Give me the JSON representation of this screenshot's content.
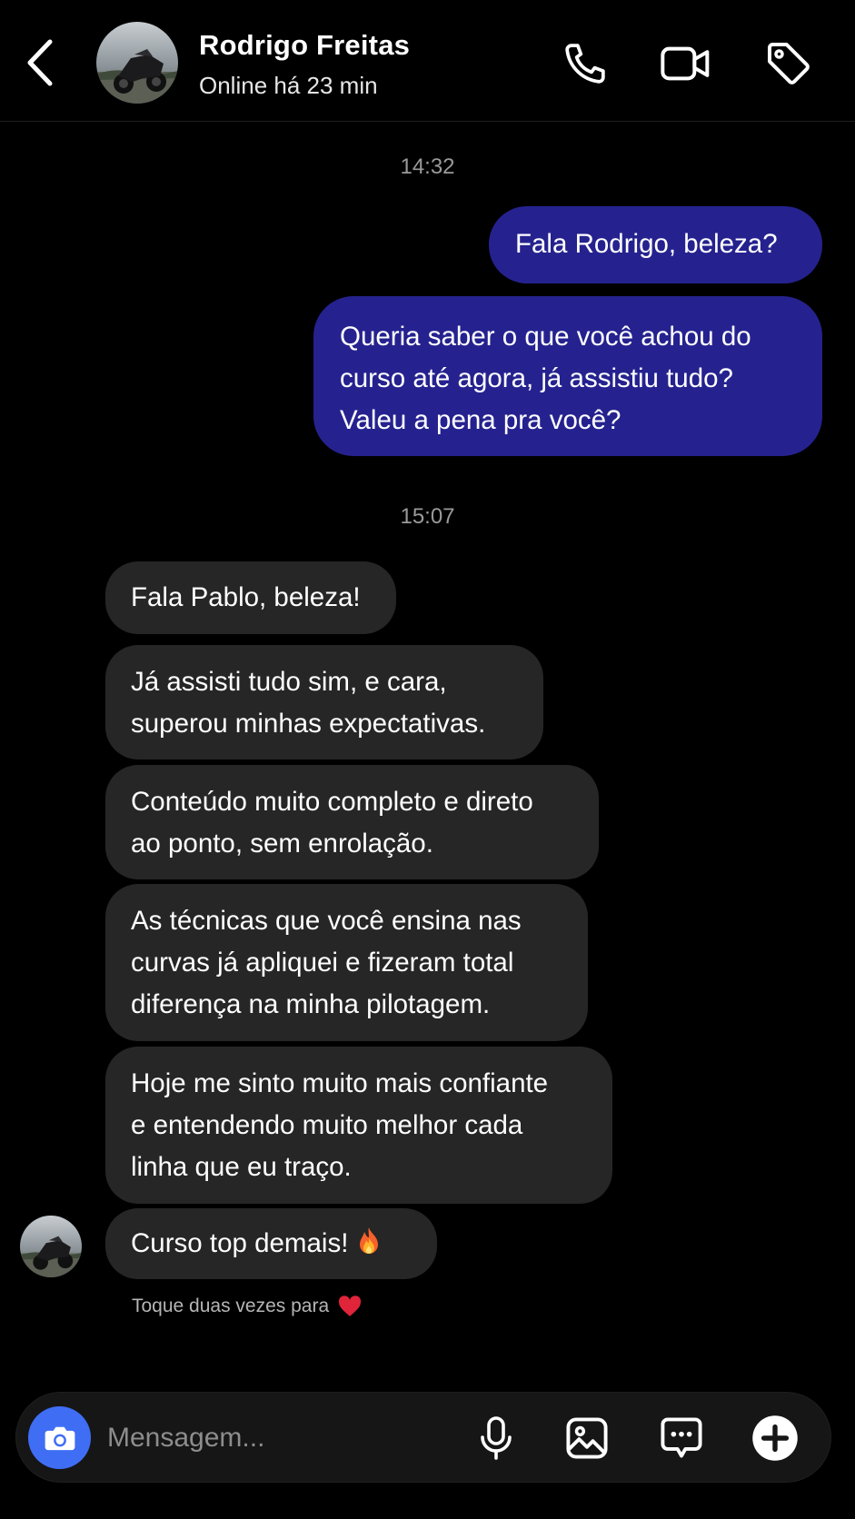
{
  "header": {
    "contact_name": "Rodrigo Freitas",
    "contact_status": "Online há 23 min",
    "icons": [
      "back-chevron-icon",
      "phone-icon",
      "video-camera-icon",
      "tag-icon"
    ]
  },
  "conversation": {
    "timestamps": [
      "14:32",
      "15:07"
    ],
    "outgoing": [
      {
        "text": "Fala Rodrigo, beleza?"
      },
      {
        "text": "Queria saber o que você achou do\ncurso até agora, já assistiu tudo?\nValeu a pena pra você?"
      }
    ],
    "incoming": [
      {
        "text": "Fala Pablo, beleza!"
      },
      {
        "text": "Já assisti tudo sim, e cara,\nsuperou minhas expectativas."
      },
      {
        "text": "Conteúdo muito completo e direto\nao ponto, sem enrolação."
      },
      {
        "text": "As técnicas que você ensina nas\ncurvas já apliquei e fizeram total\ndiferença na minha pilotagem."
      },
      {
        "text": "Hoje me sinto muito mais confiante\ne entendendo muito melhor cada\nlinha que eu traço."
      },
      {
        "text": "Curso top demais!",
        "emoji": "fire-emoji"
      }
    ],
    "reaction_hint": "Toque duas vezes para",
    "reaction_emoji": "red-heart-emoji"
  },
  "composer": {
    "placeholder": "Mensagem...",
    "icons": [
      "camera-icon",
      "microphone-icon",
      "gallery-icon",
      "sticker-icon",
      "plus-icon"
    ]
  },
  "colors": {
    "background": "#000000",
    "outgoing_bubble": "#25228f",
    "incoming_bubble": "#262626",
    "camera_button": "#3f6ef5",
    "timestamp_text": "#9a9a9a"
  }
}
